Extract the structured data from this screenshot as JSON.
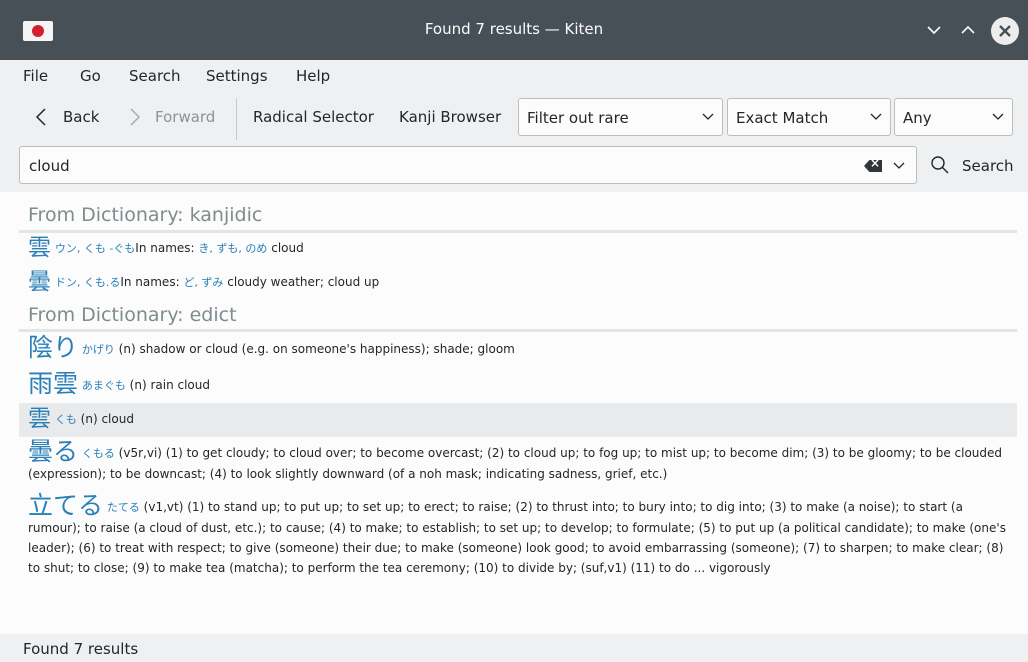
{
  "window": {
    "title": "Found 7 results — Kiten",
    "buttons": {
      "minimize": "chevron-down",
      "maximize": "chevron-up",
      "close": "×"
    }
  },
  "menu": {
    "items": [
      "File",
      "Go",
      "Search",
      "Settings",
      "Help"
    ]
  },
  "toolbar": {
    "back_label": "Back",
    "forward_label": "Forward",
    "radical_selector_label": "Radical Selector",
    "kanji_browser_label": "Kanji Browser",
    "rare_filter": "Filter out rare",
    "match_type": "Exact Match",
    "word_type": "Any"
  },
  "search": {
    "query": "cloud",
    "button_label": "Search"
  },
  "results": {
    "sections": [
      {
        "header": "From Dictionary: kanjidic",
        "entries": [
          {
            "word": "雲",
            "reading": "ウン, くも -ぐも",
            "names_label": "In names: ",
            "names": "き, ずも, のめ",
            "gloss": "cloud"
          },
          {
            "word": "曇",
            "reading": "ドン, くも.る",
            "names_label": "In names: ",
            "names": "ど, ずみ",
            "gloss": "cloudy weather; cloud up"
          }
        ]
      },
      {
        "header": "From Dictionary: edict",
        "entries": [
          {
            "word": "陰り",
            "reading": "かげり",
            "gloss": "(n) shadow or cloud (e.g. on someone's happiness); shade; gloom"
          },
          {
            "word": "雨雲",
            "reading": "あまぐも",
            "gloss": "(n) rain cloud"
          },
          {
            "word": "雲",
            "reading": "くも",
            "gloss": "(n) cloud"
          },
          {
            "word": "曇る",
            "reading": "くもる",
            "gloss": "(v5r,vi) (1) to get cloudy; to cloud over; to become overcast; (2) to cloud up; to fog up; to mist up; to become dim; (3) to be gloomy; to be clouded (expression); to be downcast; (4) to look slightly downward (of a noh mask; indicating sadness, grief, etc.)"
          },
          {
            "word": "立てる",
            "reading": "たてる",
            "gloss": "(v1,vt) (1) to stand up; to put up; to set up; to erect; to raise; (2) to thrust into; to bury into; to dig into; (3) to make (a noise); to start (a rumour); to raise (a cloud of dust, etc.); to cause; (4) to make; to establish; to set up; to develop; to formulate; (5) to put up (a political candidate); to make (one's leader); (6) to treat with respect; to give (someone) their due; to make (someone) look good; to avoid embarrassing (someone); (7) to sharpen; to make clear; (8) to shut; to close; (9) to make tea (matcha); to perform the tea ceremony; (10) to divide by; (suf,v1) (11) to do ... vigorously"
          }
        ]
      }
    ]
  },
  "status": {
    "text": "Found 7 results"
  }
}
